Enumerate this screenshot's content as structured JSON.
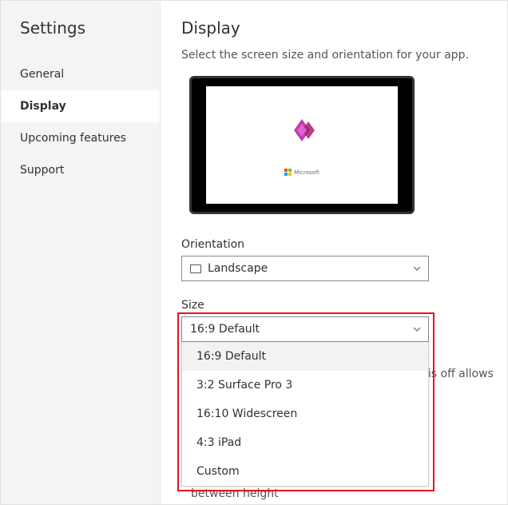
{
  "sidebar": {
    "title": "Settings",
    "items": [
      {
        "label": "General"
      },
      {
        "label": "Display"
      },
      {
        "label": "Upcoming features"
      },
      {
        "label": "Support"
      }
    ]
  },
  "main": {
    "title": "Display",
    "description": "Select the screen size and orientation for your app."
  },
  "preview": {
    "brand": "Microsoft"
  },
  "orientation": {
    "label": "Orientation",
    "value": "Landscape"
  },
  "size": {
    "label": "Size",
    "value": "16:9 Default",
    "options": [
      "16:9 Default",
      "3:2 Surface Pro 3",
      "16:10 Widescreen",
      "4:3 iPad",
      "Custom"
    ]
  },
  "ghost": {
    "line1": "his off allows",
    "line2": "between height"
  }
}
